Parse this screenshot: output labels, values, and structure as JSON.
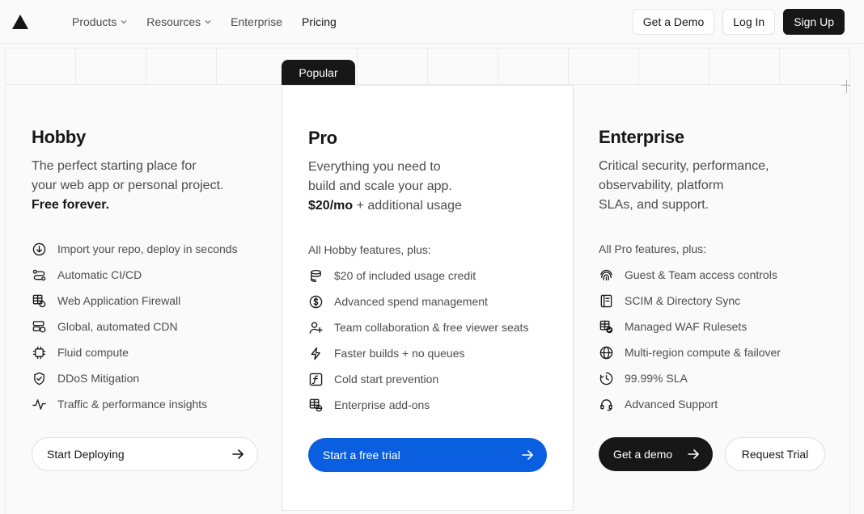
{
  "nav": {
    "links": [
      {
        "label": "Products",
        "has_menu": true
      },
      {
        "label": "Resources",
        "has_menu": true
      },
      {
        "label": "Enterprise",
        "has_menu": false
      },
      {
        "label": "Pricing",
        "has_menu": false
      }
    ],
    "get_demo": "Get a Demo",
    "log_in": "Log In",
    "sign_up": "Sign Up"
  },
  "badge": "Popular",
  "plans": {
    "hobby": {
      "title": "Hobby",
      "desc_line1": "The perfect starting place for",
      "desc_line2": "your web app or personal project.",
      "desc_line3": "Free forever.",
      "features": [
        {
          "icon": "arrow-down-circle-icon",
          "label": "Import your repo, deploy in seconds"
        },
        {
          "icon": "ci-cd-icon",
          "label": "Automatic CI/CD"
        },
        {
          "icon": "firewall-icon",
          "label": "Web Application Firewall"
        },
        {
          "icon": "cdn-icon",
          "label": "Global, automated CDN"
        },
        {
          "icon": "chip-icon",
          "label": "Fluid compute"
        },
        {
          "icon": "shield-check-icon",
          "label": "DDoS Mitigation"
        },
        {
          "icon": "pulse-icon",
          "label": "Traffic & performance insights"
        }
      ],
      "cta": "Start Deploying"
    },
    "pro": {
      "title": "Pro",
      "desc_line1": "Everything you need to",
      "desc_line2": "build and scale your app.",
      "price": "$20/mo",
      "price_suffix": " + additional usage",
      "features_head": "All Hobby features, plus:",
      "features": [
        {
          "icon": "coins-icon",
          "label": "$20 of included usage credit"
        },
        {
          "icon": "dollar-circle-icon",
          "label": "Advanced spend management"
        },
        {
          "icon": "user-plus-icon",
          "label": "Team collaboration & free viewer seats"
        },
        {
          "icon": "lightning-icon",
          "label": "Faster builds + no queues"
        },
        {
          "icon": "function-icon",
          "label": "Cold start prevention"
        },
        {
          "icon": "grid-globe-icon",
          "label": "Enterprise add-ons"
        }
      ],
      "cta": "Start a free trial"
    },
    "enterprise": {
      "title": "Enterprise",
      "desc_line1": "Critical security, performance,",
      "desc_line2": "observability, platform",
      "desc_line3": "SLAs, and support.",
      "features_head": "All Pro features, plus:",
      "features": [
        {
          "icon": "fingerprint-icon",
          "label": "Guest & Team access controls"
        },
        {
          "icon": "directory-icon",
          "label": "SCIM & Directory Sync"
        },
        {
          "icon": "waf-check-icon",
          "label": "Managed WAF Rulesets"
        },
        {
          "icon": "globe-icon",
          "label": "Multi-region compute & failover"
        },
        {
          "icon": "clock-icon",
          "label": "99.99% SLA"
        },
        {
          "icon": "headset-icon",
          "label": "Advanced Support"
        }
      ],
      "cta_demo": "Get a demo",
      "cta_trial": "Request Trial"
    }
  },
  "colors": {
    "accent_blue": "#0a5fe0",
    "dark": "#171717",
    "background": "#fafafa"
  }
}
